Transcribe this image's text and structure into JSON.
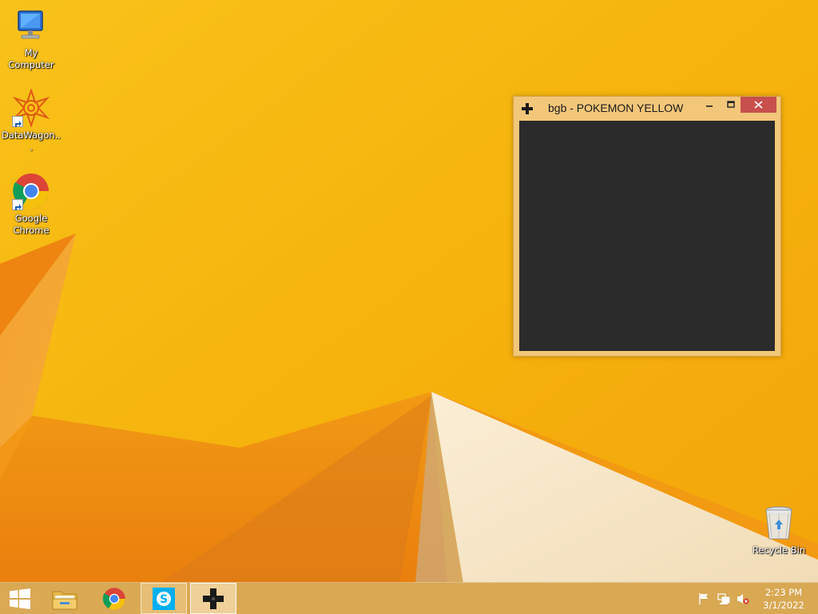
{
  "desktop": {
    "icons": [
      {
        "label": "My Computer",
        "icon": "computer-icon"
      },
      {
        "label": "DataWagon...",
        "icon": "datawagon-icon",
        "shortcut": true
      },
      {
        "label": "Google\nChrome",
        "icon": "chrome-icon",
        "shortcut": true
      }
    ],
    "recycle_bin": {
      "label": "Recycle Bin",
      "icon": "recycle-bin-icon"
    }
  },
  "window": {
    "title": "bgb - POKEMON YELLOW",
    "app_icon": "dpad-icon",
    "controls": {
      "minimize": "–",
      "maximize": "☐",
      "close": "✕"
    },
    "screen_color": "#2b2b2b",
    "frame_color": "#f3c77a",
    "close_color": "#c7504d"
  },
  "taskbar": {
    "items": [
      {
        "name": "start-button",
        "icon": "windows-logo-icon"
      },
      {
        "name": "file-explorer",
        "icon": "folder-icon"
      },
      {
        "name": "google-chrome",
        "icon": "chrome-icon"
      },
      {
        "name": "skype",
        "icon": "skype-icon",
        "state": "running"
      },
      {
        "name": "bgb",
        "icon": "dpad-icon",
        "state": "focused"
      }
    ],
    "tray": {
      "icons": [
        "flag-icon",
        "network-icon",
        "volume-muted-icon"
      ],
      "time": "2:23 PM",
      "date": "3/1/2022"
    }
  },
  "colors": {
    "wallpaper": "#f7b40f",
    "taskbar": "#d6a85a"
  }
}
